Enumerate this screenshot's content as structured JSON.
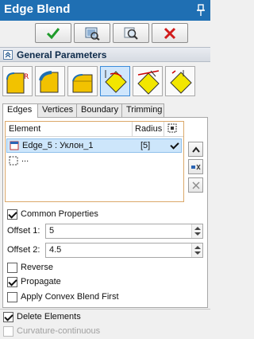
{
  "window": {
    "title": "Edge Blend"
  },
  "toolbar": {
    "buttons": [
      {
        "name": "ok",
        "icon": "checkmark-icon",
        "color": "#1f9b2b"
      },
      {
        "name": "preview",
        "icon": "preview-icon"
      },
      {
        "name": "zoom-preview",
        "icon": "magnifier-icon"
      },
      {
        "name": "cancel",
        "icon": "cross-icon",
        "color": "#d11b1b"
      }
    ]
  },
  "section": {
    "title": "General Parameters"
  },
  "modes": {
    "active_index": 3,
    "items": [
      {
        "icon": "blend-radius-icon"
      },
      {
        "icon": "blend-chord-icon"
      },
      {
        "icon": "blend-setback-icon"
      },
      {
        "icon": "blend-variable-icon"
      },
      {
        "icon": "blend-chamfer-icon"
      },
      {
        "icon": "blend-vertex-icon"
      }
    ]
  },
  "tabs": [
    "Edges",
    "Vertices",
    "Boundary",
    "Trimming"
  ],
  "grid": {
    "headers": {
      "element": "Element",
      "radius": "Radius"
    },
    "rows": [
      {
        "element": "Edge_5 : Уклон_1",
        "radius": "[5]",
        "checked": true
      },
      {
        "element": "...",
        "radius": "",
        "checked": false
      }
    ]
  },
  "common_properties": {
    "label": "Common Properties",
    "checked": true
  },
  "offset1": {
    "label": "Offset 1:",
    "value": "5"
  },
  "offset2": {
    "label": "Offset 2:",
    "value": "4.5"
  },
  "reverse": {
    "label": "Reverse",
    "checked": false
  },
  "propagate": {
    "label": "Propagate",
    "checked": true
  },
  "apply_convex": {
    "label": "Apply Convex Blend First",
    "checked": false
  },
  "delete_elements": {
    "label": "Delete Elements",
    "checked": true
  },
  "curvature_continuous": {
    "label": "Curvature-continuous",
    "checked": false,
    "disabled": true
  }
}
